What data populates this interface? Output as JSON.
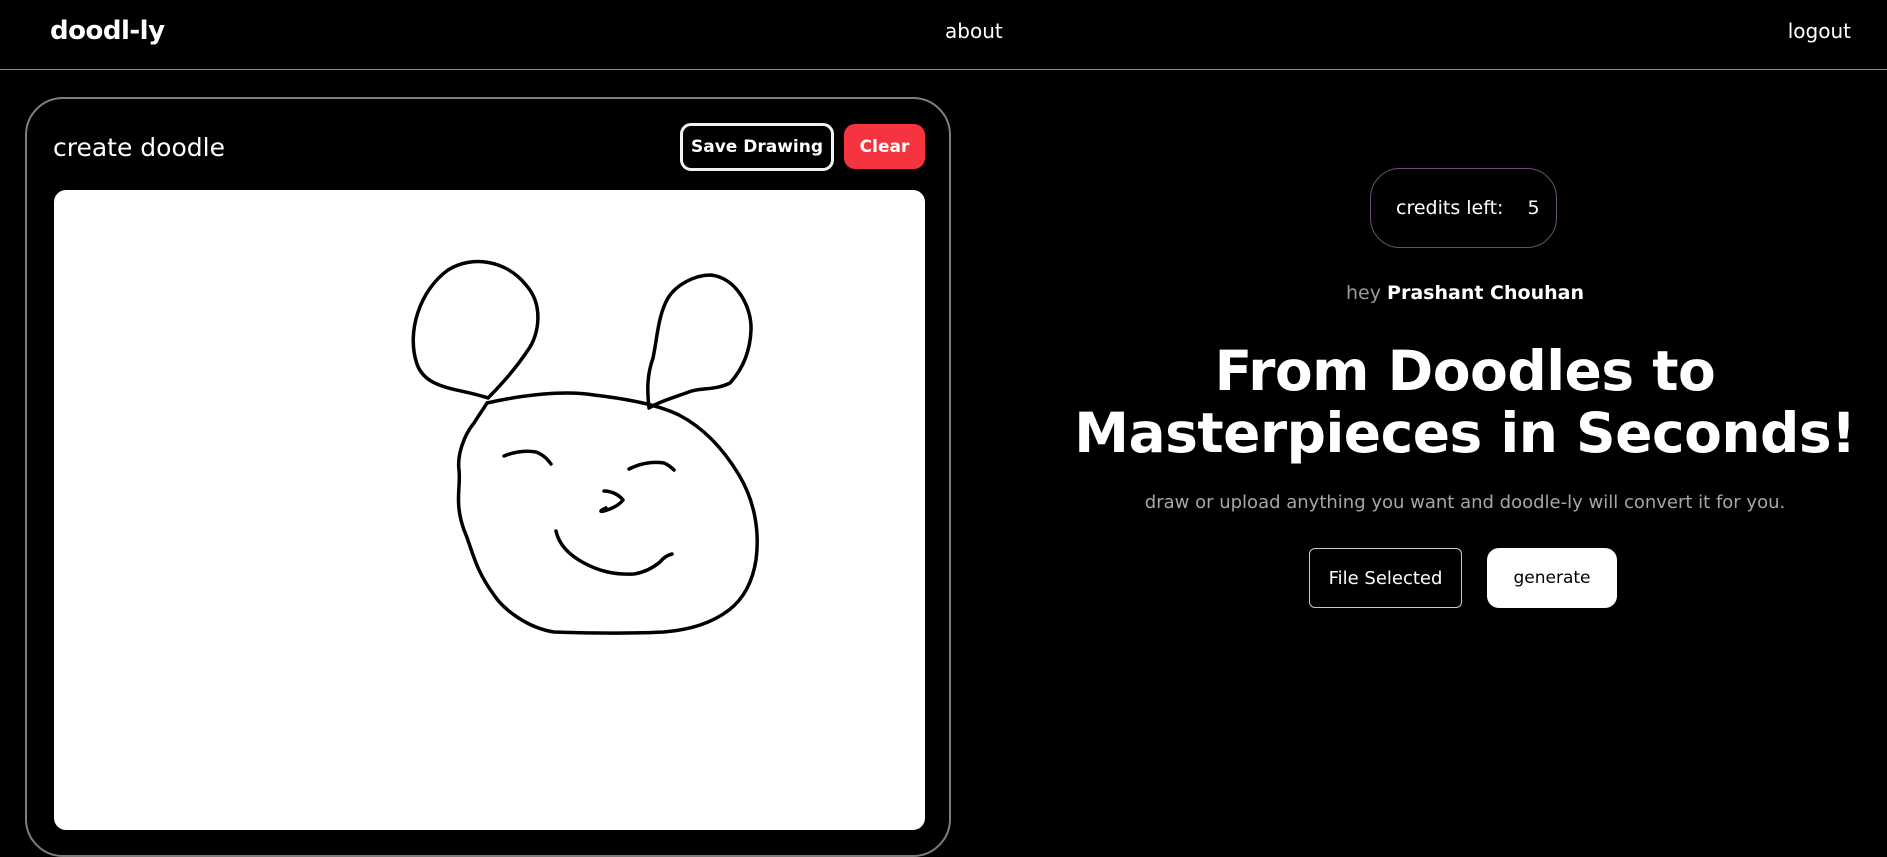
{
  "nav": {
    "brand": "doodl-ly",
    "about": "about",
    "logout": "logout"
  },
  "editor": {
    "title": "create doodle",
    "save_label": "Save Drawing",
    "clear_label": "Clear",
    "drawing": "bear face doodle"
  },
  "credits": {
    "label": "credits left:",
    "value": "5"
  },
  "greeting": {
    "prefix": "hey",
    "name": "Prashant Chouhan"
  },
  "hero": {
    "line1": "From Doodles to",
    "line2": "Masterpieces in Seconds!",
    "subtitle": "draw or upload anything you want and doodle-ly will convert it for you."
  },
  "actions": {
    "file_label": "File Selected",
    "generate_label": "generate"
  },
  "colors": {
    "background": "#000000",
    "clear_button": "#f5343f",
    "canvas": "#ffffff"
  }
}
